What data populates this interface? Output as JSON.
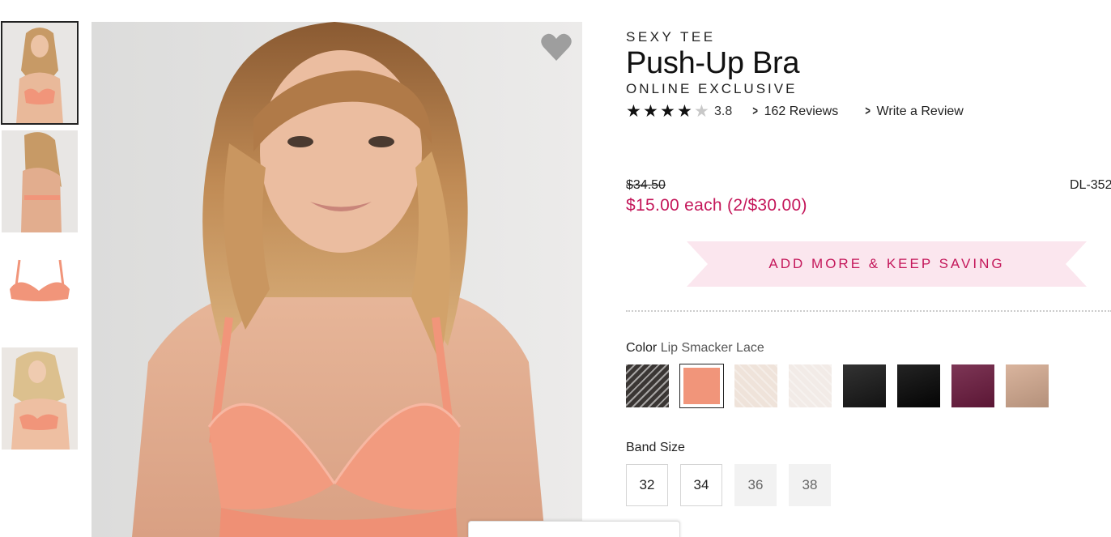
{
  "product": {
    "collection": "SEXY TEE",
    "title": "Push-Up Bra",
    "subtitle": "ONLINE EXCLUSIVE",
    "rating": 3.8,
    "rating_text": "3.8",
    "reviews_link": "162 Reviews",
    "write_review_link": "Write a Review",
    "original_price": "$34.50",
    "sale_price": "$15.00 each (2/$30.00)",
    "sku": "DL-352"
  },
  "promo": {
    "label": "ADD MORE & KEEP SAVING"
  },
  "color": {
    "label": "Color",
    "selected": "Lip Smacker Lace",
    "swatches": [
      {
        "name": "black-white-lace",
        "color": "#3a3634"
      },
      {
        "name": "lip-smacker-lace",
        "color": "#f1957a"
      },
      {
        "name": "nude-lace",
        "color": "#efe3da"
      },
      {
        "name": "white-lace",
        "color": "#f2ebe7"
      },
      {
        "name": "black",
        "color": "#161616"
      },
      {
        "name": "black-2",
        "color": "#050505"
      },
      {
        "name": "plum",
        "color": "#6b1a3e"
      },
      {
        "name": "tan",
        "color": "#d4aa90"
      }
    ]
  },
  "band_size": {
    "label": "Band Size",
    "sizes": [
      {
        "label": "32",
        "available": true
      },
      {
        "label": "34",
        "available": true
      },
      {
        "label": "36",
        "available": false
      },
      {
        "label": "38",
        "available": false
      }
    ]
  },
  "icons": {
    "favorite": "heart-icon",
    "chevron": "chevron-right-icon"
  },
  "colors": {
    "accent": "#c4175a",
    "promo_bg": "#fbe6ee",
    "heart": "#9e9e9e"
  }
}
